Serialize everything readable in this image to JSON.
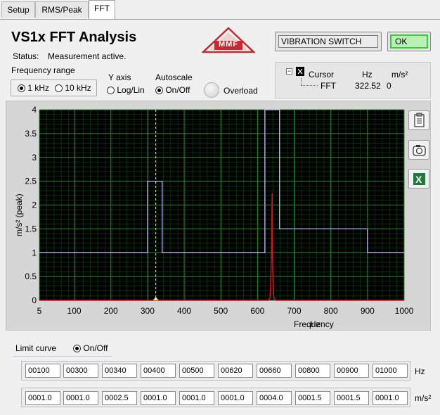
{
  "tabs": [
    {
      "label": "Setup"
    },
    {
      "label": "RMS/Peak"
    },
    {
      "label": "FFT"
    }
  ],
  "header": {
    "title": "VS1x FFT Analysis",
    "status_label": "Status:",
    "status_value": "Measurement active.",
    "logo_text": "MMF"
  },
  "buttons": {
    "vibration_switch": "VIBRATION SWITCH",
    "ok": "OK"
  },
  "frequency_range": {
    "label": "Frequency range",
    "options": [
      "1 kHz",
      "10 kHz"
    ],
    "selected": "1 kHz"
  },
  "y_axis": {
    "label": "Y axis",
    "option": "Log/Lin",
    "selected": false
  },
  "autoscale": {
    "label": "Autoscale",
    "option": "On/Off",
    "selected": true
  },
  "overload": {
    "label": "Overload"
  },
  "cursor": {
    "tree_label": "Cursor",
    "col_hz": "Hz",
    "col_unit": "m/s²",
    "row_name": "FFT",
    "hz_value": "322.52",
    "unit_value": "0"
  },
  "chart_data": {
    "type": "line",
    "xlabel": "Frequency",
    "xunit": "Hz",
    "ylabel": "m/s² (peak)",
    "xlim": [
      5,
      1000
    ],
    "ylim": [
      0,
      4
    ],
    "x_ticks": [
      "5",
      "100",
      "200",
      "300",
      "400",
      "500",
      "600",
      "700",
      "800",
      "900",
      "1000"
    ],
    "y_ticks": [
      "0",
      "0.5",
      "1",
      "1.5",
      "2",
      "2.5",
      "3",
      "3.5",
      "4"
    ],
    "grid": true,
    "cursor_x": 322.52,
    "series": [
      {
        "color": "#b8b2f0",
        "points": [
          [
            5,
            1
          ],
          [
            300,
            1
          ],
          [
            300,
            2.5
          ],
          [
            340,
            2.5
          ],
          [
            340,
            1
          ],
          [
            620,
            1
          ],
          [
            620,
            4
          ],
          [
            660,
            4
          ],
          [
            660,
            1.5
          ],
          [
            900,
            1.5
          ],
          [
            900,
            1
          ],
          [
            1000,
            1
          ]
        ]
      },
      {
        "color": "#e01010",
        "points": [
          [
            5,
            0
          ],
          [
            630,
            0
          ],
          [
            634,
            0.05
          ],
          [
            636,
            0.35
          ],
          [
            638,
            1.0
          ],
          [
            640,
            2.25
          ],
          [
            641,
            0.9
          ],
          [
            642,
            0.45
          ],
          [
            643,
            0.25
          ],
          [
            645,
            0.05
          ],
          [
            650,
            0
          ],
          [
            1000,
            0
          ]
        ]
      }
    ]
  },
  "limit_curve": {
    "label": "Limit curve",
    "option": "On/Off",
    "selected": true,
    "hz_unit": "Hz",
    "amp_unit": "m/s²",
    "hz_values": [
      "00100",
      "00300",
      "00340",
      "00400",
      "00500",
      "00620",
      "00660",
      "00800",
      "00900",
      "01000"
    ],
    "amp_values": [
      "0001.0",
      "0001.0",
      "0002.5",
      "0001.0",
      "0001.0",
      "0001.0",
      "0004.0",
      "0001.5",
      "0001.5",
      "0001.0"
    ]
  },
  "icons": [
    "clipboard-icon",
    "camera-icon",
    "excel-icon"
  ]
}
